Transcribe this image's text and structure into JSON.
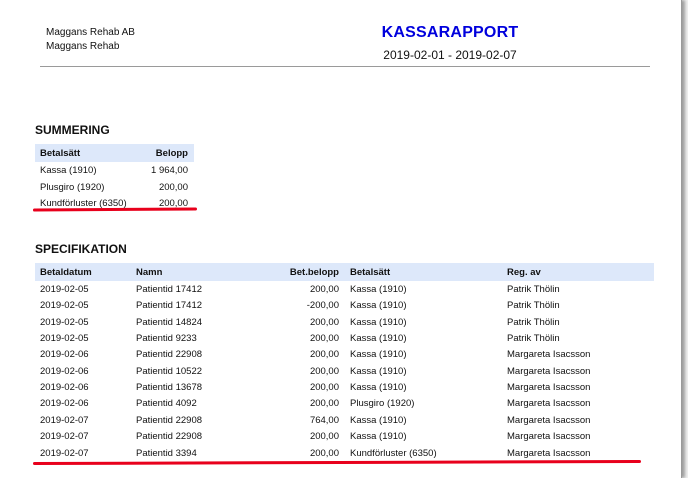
{
  "header": {
    "company_line1": "Maggans Rehab AB",
    "company_line2": "Maggans Rehab",
    "title": "KASSARAPPORT",
    "period": "2019-02-01 - 2019-02-07"
  },
  "colors": {
    "title": "#0000dd",
    "header_bg": "#dde8fa",
    "highlight": "#e8001c"
  },
  "summering": {
    "title": "SUMMERING",
    "headers": [
      "Betalsätt",
      "Belopp"
    ],
    "rows": [
      [
        "Kassa (1910)",
        "1 964,00"
      ],
      [
        "Plusgiro (1920)",
        "200,00"
      ],
      [
        "Kundförluster (6350)",
        "200,00"
      ]
    ]
  },
  "specifikation": {
    "title": "SPECIFIKATION",
    "headers": [
      "Betaldatum",
      "Namn",
      "Bet.belopp",
      "Betalsätt",
      "Reg. av"
    ],
    "rows": [
      [
        "2019-02-05",
        "Patientid 17412",
        "200,00",
        "Kassa (1910)",
        "Patrik Thölin"
      ],
      [
        "2019-02-05",
        "Patientid 17412",
        "-200,00",
        "Kassa (1910)",
        "Patrik Thölin"
      ],
      [
        "2019-02-05",
        "Patientid 14824",
        "200,00",
        "Kassa (1910)",
        "Patrik Thölin"
      ],
      [
        "2019-02-05",
        "Patientid 9233",
        "200,00",
        "Kassa (1910)",
        "Patrik Thölin"
      ],
      [
        "2019-02-06",
        "Patientid 22908",
        "200,00",
        "Kassa (1910)",
        "Margareta Isacsson"
      ],
      [
        "2019-02-06",
        "Patientid 10522",
        "200,00",
        "Kassa (1910)",
        "Margareta Isacsson"
      ],
      [
        "2019-02-06",
        "Patientid 13678",
        "200,00",
        "Kassa (1910)",
        "Margareta Isacsson"
      ],
      [
        "2019-02-06",
        "Patientid 4092",
        "200,00",
        "Plusgiro (1920)",
        "Margareta Isacsson"
      ],
      [
        "2019-02-07",
        "Patientid 22908",
        "764,00",
        "Kassa (1910)",
        "Margareta Isacsson"
      ],
      [
        "2019-02-07",
        "Patientid 22908",
        "200,00",
        "Kassa (1910)",
        "Margareta Isacsson"
      ],
      [
        "2019-02-07",
        "Patientid 3394",
        "200,00",
        "Kundförluster (6350)",
        "Margareta Isacsson"
      ]
    ]
  }
}
